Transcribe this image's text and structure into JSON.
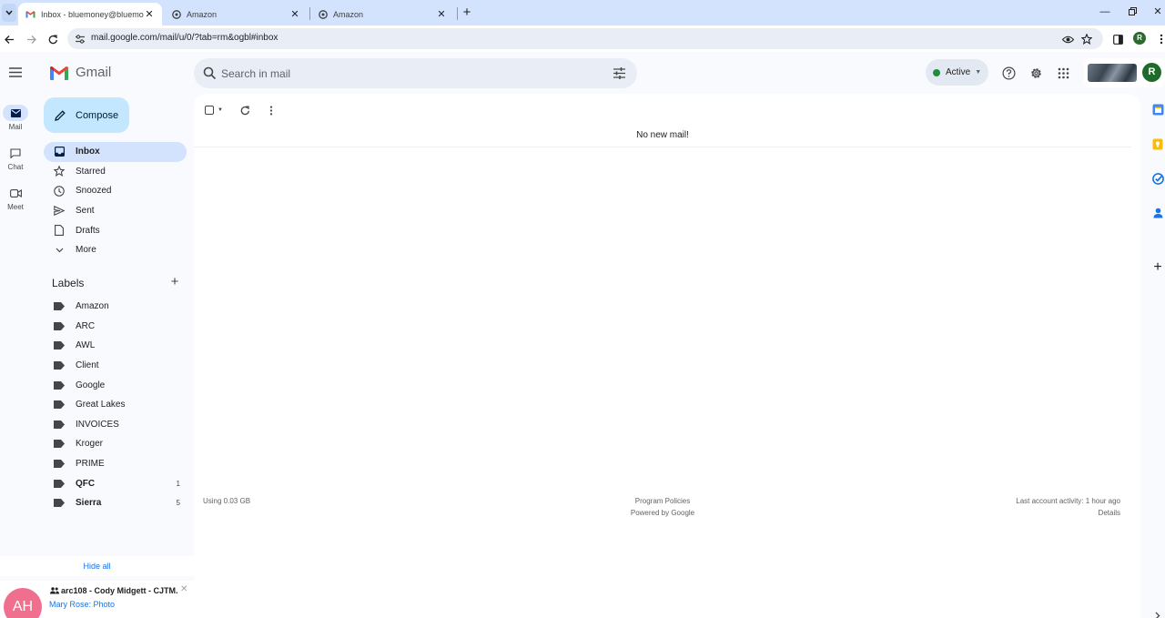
{
  "browser": {
    "tabs": [
      {
        "title": "Inbox - bluemoney@bluemone",
        "active": true
      },
      {
        "title": "Amazon",
        "active": false
      },
      {
        "title": "Amazon",
        "active": false
      }
    ],
    "url": "mail.google.com/mail/u/0/?tab=rm&ogbl#inbox",
    "profile_initial": "R"
  },
  "header": {
    "brand": "Gmail",
    "search_placeholder": "Search in mail",
    "status_label": "Active",
    "status_color": "#1e8e3e",
    "avatar_initial": "R"
  },
  "rail": [
    {
      "label": "Mail",
      "icon": "mail-icon",
      "selected": true
    },
    {
      "label": "Chat",
      "icon": "chat-icon",
      "selected": false
    },
    {
      "label": "Meet",
      "icon": "meet-icon",
      "selected": false
    }
  ],
  "compose_label": "Compose",
  "nav": [
    {
      "label": "Inbox",
      "icon": "inbox-icon",
      "selected": true
    },
    {
      "label": "Starred",
      "icon": "star-icon"
    },
    {
      "label": "Snoozed",
      "icon": "clock-icon"
    },
    {
      "label": "Sent",
      "icon": "send-icon"
    },
    {
      "label": "Drafts",
      "icon": "draft-icon"
    },
    {
      "label": "More",
      "icon": "chevron-down-icon"
    }
  ],
  "labels_title": "Labels",
  "labels": [
    {
      "name": "Amazon",
      "count": "",
      "bold": false
    },
    {
      "name": "ARC",
      "count": "",
      "bold": false
    },
    {
      "name": "AWL",
      "count": "",
      "bold": false
    },
    {
      "name": "Client",
      "count": "",
      "bold": false
    },
    {
      "name": "Google",
      "count": "",
      "bold": false
    },
    {
      "name": "Great Lakes",
      "count": "",
      "bold": false
    },
    {
      "name": "INVOICES",
      "count": "",
      "bold": false
    },
    {
      "name": "Kroger",
      "count": "",
      "bold": false
    },
    {
      "name": "PRIME",
      "count": "",
      "bold": false
    },
    {
      "name": "QFC",
      "count": "1",
      "bold": true
    },
    {
      "name": "Sierra",
      "count": "5",
      "bold": true
    }
  ],
  "hide_all": "Hide all",
  "chat_card": {
    "avatar": "AH",
    "title": "arc108 - Cody Midgett - CJTM...",
    "subtitle": "Mary Rose: Photo"
  },
  "main": {
    "empty_message": "No new mail!",
    "storage": "Using 0.03 GB",
    "policies": "Program Policies",
    "powered": "Powered by Google",
    "last_activity": "Last account activity: 1 hour ago",
    "details": "Details"
  }
}
